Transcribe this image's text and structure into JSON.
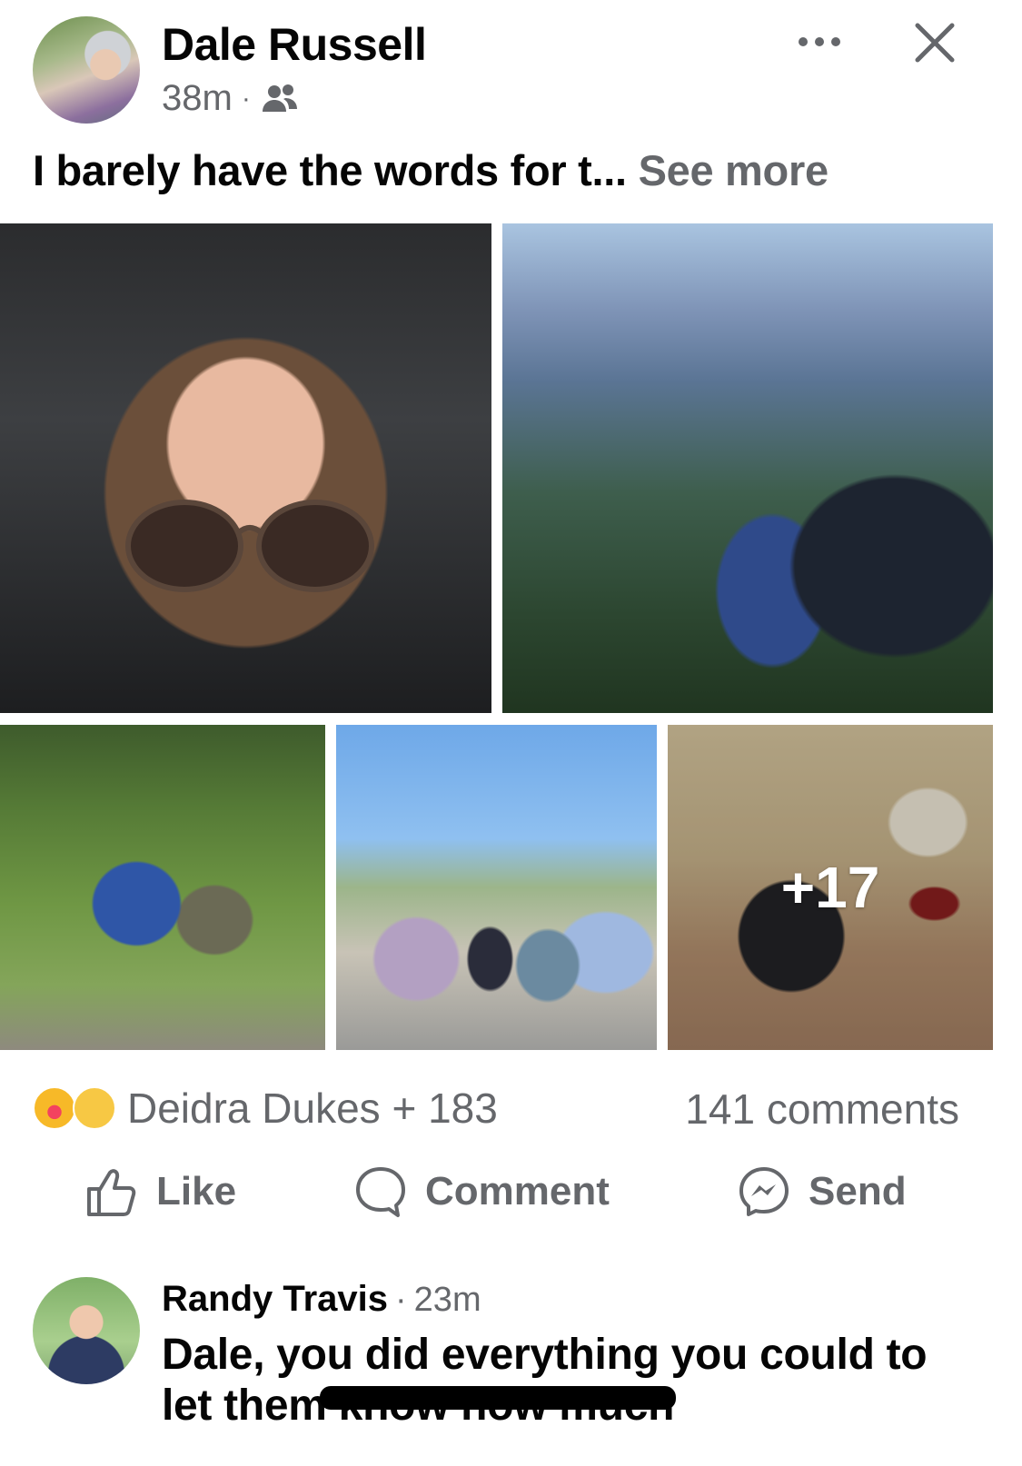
{
  "post": {
    "author": "Dale Russell",
    "time": "38m",
    "separator": "·",
    "audience_icon": "friends-icon",
    "text": "I barely have the words for t...",
    "see_more": "See more"
  },
  "photos": {
    "extra_count": "+17"
  },
  "reactions": {
    "icons": [
      "care-reaction-icon",
      "sad-reaction-icon"
    ],
    "summary": "Deidra Dukes + 183",
    "comments": "141 comments"
  },
  "actions": {
    "like": "Like",
    "comment": "Comment",
    "send": "Send"
  },
  "comment": {
    "author": "Randy Travis",
    "separator": "·",
    "time": "23m",
    "text": "Dale, you did everything you could to let them know how much"
  },
  "colors": {
    "primary_text": "#050505",
    "secondary_text": "#65676b",
    "background": "#ffffff"
  }
}
